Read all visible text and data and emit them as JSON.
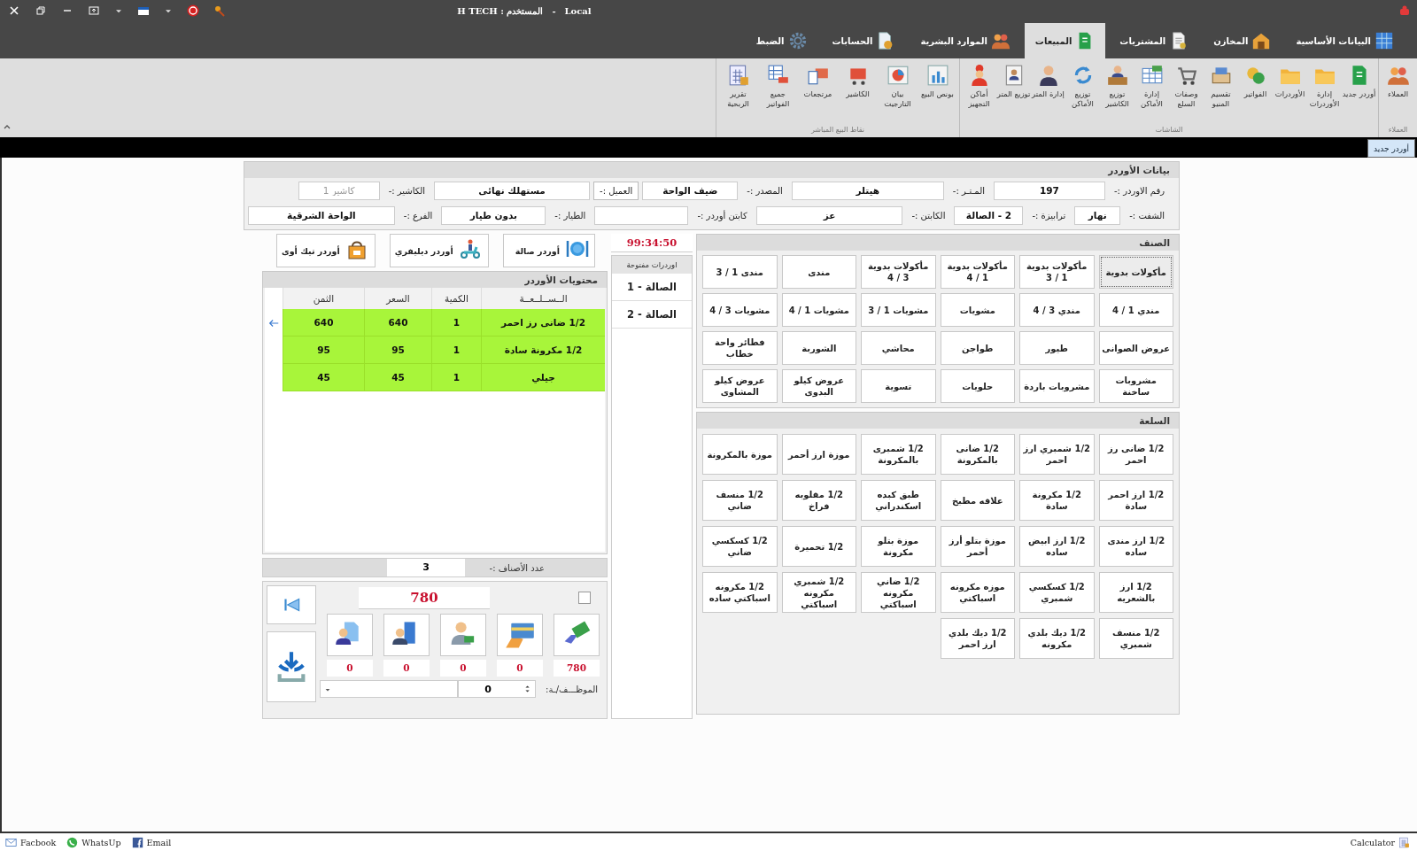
{
  "title_bar": {
    "user": "H TECH : المستخدم",
    "separator": "-",
    "server": "Local"
  },
  "menu_tabs": [
    {
      "label": "البيانات الأساسية",
      "selected": false
    },
    {
      "label": "المخازن",
      "selected": false
    },
    {
      "label": "المشتريات",
      "selected": false
    },
    {
      "label": "المبيعات",
      "selected": true
    },
    {
      "label": "الموارد البشرية",
      "selected": false
    },
    {
      "label": "الحسابات",
      "selected": false
    },
    {
      "label": "الضبط",
      "selected": false
    }
  ],
  "ribbon": [
    {
      "label": "العملاء",
      "items": [
        "العملاء"
      ]
    },
    {
      "label": "الشاشات",
      "items": [
        "أوردر جديد",
        "إدارة الأوردرات",
        "الأوردرات",
        "الفواتير",
        "تقسيم المنيو",
        "وصفات السلع",
        "إدارة الأماكن",
        "توزيع الكاشير",
        "توزيع الأماكن",
        "إدارة المتر",
        "توزيع المتر",
        "أماكن التجهيز"
      ]
    },
    {
      "label": "نقاط البيع المباشر",
      "items": [
        "بونص البيع",
        "بيان التارجيت",
        "الكاشير",
        "مرتجعات",
        "جميع الفواتير",
        "تقرير الربحية"
      ]
    }
  ],
  "doc_tabs": [
    {
      "label": "أوردر جديد",
      "selected": true
    }
  ],
  "order_info": {
    "title": "بيانات الأوردر",
    "first_line": [
      {
        "label": "رقم الاوردر :-",
        "value": "197",
        "kind": "plain"
      },
      {
        "label": "المـتـر :-",
        "value": "هيتلر",
        "kind": "plain"
      },
      {
        "label": "المصدر :-",
        "value": "ضيف الواحة",
        "kind": "plain"
      },
      {
        "label": "العميل :-",
        "value": "مستهلك نهائي",
        "kind": "lookup"
      },
      {
        "label": "الكاشير :-",
        "placeholder": "كاشير 1",
        "kind": "plain"
      }
    ],
    "second_line": [
      {
        "label": "الشفت :-",
        "value": "نهار",
        "kind": "plain"
      },
      {
        "label": "ترابيزة :-",
        "value": "2 - الصالة",
        "kind": "plain"
      },
      {
        "label": "الكابتن :-",
        "value": "عز",
        "kind": "plain"
      },
      {
        "label": "كابتن أوردر :-",
        "kind": "plain"
      },
      {
        "label": "الطيار :-",
        "value": "بدون طيار",
        "kind": "plain"
      },
      {
        "label": "الفرع :-",
        "value": "الواحة الشرقية",
        "kind": "plain"
      }
    ]
  },
  "categories": {
    "title": "الصنف",
    "items": [
      {
        "label": "مأكولات بدوية",
        "selected": true
      },
      {
        "label": "مأكولات بدوية 1 / 3",
        "selected": false
      },
      {
        "label": "مأكولات بدوية 1 / 4",
        "selected": false
      },
      {
        "label": "مأكولات بدوية 3 / 4",
        "selected": false
      },
      {
        "label": "مندى",
        "selected": false
      },
      {
        "label": "مندى 1 / 3",
        "selected": false
      },
      {
        "label": "مندي 1 / 4",
        "selected": false
      },
      {
        "label": "مندي 3 / 4",
        "selected": false
      },
      {
        "label": "مشويات",
        "selected": false
      },
      {
        "label": "مشويات 1 / 3",
        "selected": false
      },
      {
        "label": "مشويات 1 / 4",
        "selected": false
      },
      {
        "label": "مشويات 3 / 4",
        "selected": false
      },
      {
        "label": "عروض الصوانى",
        "selected": false
      },
      {
        "label": "طيور",
        "selected": false
      },
      {
        "label": "طواجن",
        "selected": false
      },
      {
        "label": "محاشي",
        "selected": false
      },
      {
        "label": "الشوربة",
        "selected": false
      },
      {
        "label": "فطائر واحة خطاب",
        "selected": false
      },
      {
        "label": "مشروبات ساخنة",
        "selected": false
      },
      {
        "label": "مشروبات باردة",
        "selected": false
      },
      {
        "label": "حلويات",
        "selected": false
      },
      {
        "label": "تسوية",
        "selected": false
      },
      {
        "label": "عروض كيلو البدوى",
        "selected": false
      },
      {
        "label": "عروض كيلو المشاوى",
        "selected": false
      }
    ]
  },
  "products": {
    "title": "السلعة",
    "items": [
      "1/2 ضانى رز احمر",
      "1/2 شمبري ارز احمر",
      "1/2 ضانى بالمكرونة",
      "1/2 شمبرى بالمكرونة",
      "موزة ارز أحمر",
      "موزة بالمكرونة",
      "1/2 ارز احمر سادة",
      "1/2 مكرونة سادة",
      "علاقه مطبخ",
      "طبق كبده اسكندراني",
      "1/2 مقلوبه فراخ",
      "1/2 منسف ضاني",
      "1/2 ارز مندى ساده",
      "1/2 ارز ابيض ساده",
      "موزة بتلو أرز أحمر",
      "موزة بتلو مكرونة",
      "1/2 تحميرة",
      "1/2 كسكسي ضاني",
      "1/2 ارز بالشعريه",
      "1/2 كسكسي شمبري",
      "موزه مكرونه اسباكتي",
      "1/2 ضاني مكرونه اسباكتي",
      "1/2 شمبري مكرونه اسباكتي",
      "1/2 مكرونه اسباكتي ساده",
      "1/2 منسف شمبري",
      "1/2 ديك بلدي مكرونه",
      "1/2 ديك بلدي ارز احمر"
    ]
  },
  "order_types": [
    "أوردر صالة",
    "أوردر ديليفري",
    "أوردر تيك أوى"
  ],
  "timer": "99:34:50",
  "open_orders": {
    "title": "اوردرات مفتوحة",
    "items": [
      "الصالة - 1",
      "الصالة - 2"
    ]
  },
  "order_contents": {
    "title": "محتويات الأوردر",
    "columns": [
      "الــســلــعــة",
      "الكمية",
      "السعر",
      "الثمن"
    ],
    "rows": [
      {
        "cells": [
          "1/2 ضانى رز احمر",
          "1",
          "640",
          "640"
        ],
        "selected": true
      },
      {
        "cells": [
          "1/2 مكرونة سادة",
          "1",
          "95",
          "95"
        ],
        "selected": false
      },
      {
        "cells": [
          "جيلي",
          "1",
          "45",
          "45"
        ],
        "selected": false
      }
    ]
  },
  "summary": {
    "count_label": "عدد الأصناف :-",
    "count": "3",
    "total": "780",
    "checked": false,
    "payments": [
      "780",
      "0",
      "0",
      "0",
      "0"
    ],
    "staff_label": "الموظـــف/ـة:",
    "staff_value": "0"
  },
  "status_bar": {
    "links": [
      "Email",
      "WhatsUp",
      "Facbook"
    ],
    "calculator": "Calculator"
  }
}
